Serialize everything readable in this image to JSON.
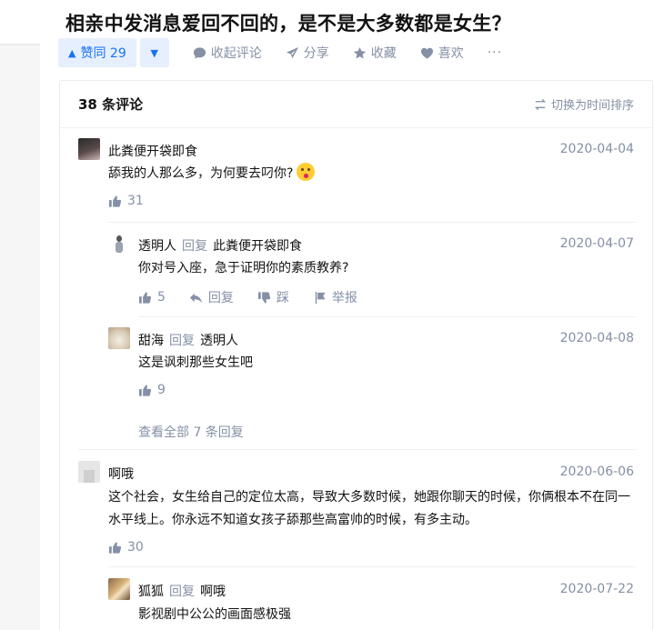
{
  "question": {
    "title": "相亲中发消息爱回不回的，是不是大多数都是女生？"
  },
  "actions": {
    "vote_up_label": "赞同 29",
    "collapse_comments": "收起评论",
    "share": "分享",
    "favorite": "收藏",
    "like": "喜欢",
    "more": "···"
  },
  "comments_panel": {
    "count_label": "38 条评论",
    "sort_label": "切换为时间排序",
    "comments": [
      {
        "author": "此粪便开袋即食",
        "date": "2020-04-04",
        "text": "舔我的人那么多，为何要去叼你?",
        "likes": "31"
      },
      {
        "author": "透明人",
        "reply_word": "回复",
        "reply_to": "此粪便开袋即食",
        "date": "2020-04-07",
        "text": "你对号入座，急于证明你的素质教养?",
        "likes": "5",
        "reply_label": "回复",
        "dislike_label": "踩",
        "report_label": "举报"
      },
      {
        "author": "甜海",
        "reply_word": "回复",
        "reply_to": "透明人",
        "date": "2020-04-08",
        "text": "这是讽刺那些女生吧",
        "likes": "9"
      },
      {
        "author": "啊哦",
        "date": "2020-06-06",
        "text": "这个社会，女生给自己的定位太高，导致大多数时候，她跟你聊天的时候，你俩根本不在同一水平线上。你永远不知道女孩子舔那些高富帅的时候，有多主动。",
        "likes": "30"
      },
      {
        "author": "狐狐",
        "reply_word": "回复",
        "reply_to": "啊哦",
        "date": "2020-07-22",
        "text": "影视剧中公公的画面感极强"
      }
    ],
    "view_all_replies": "查看全部 7 条回复"
  },
  "colors": {
    "accent": "#1772f6",
    "muted": "#8590a6",
    "text": "#121212"
  }
}
